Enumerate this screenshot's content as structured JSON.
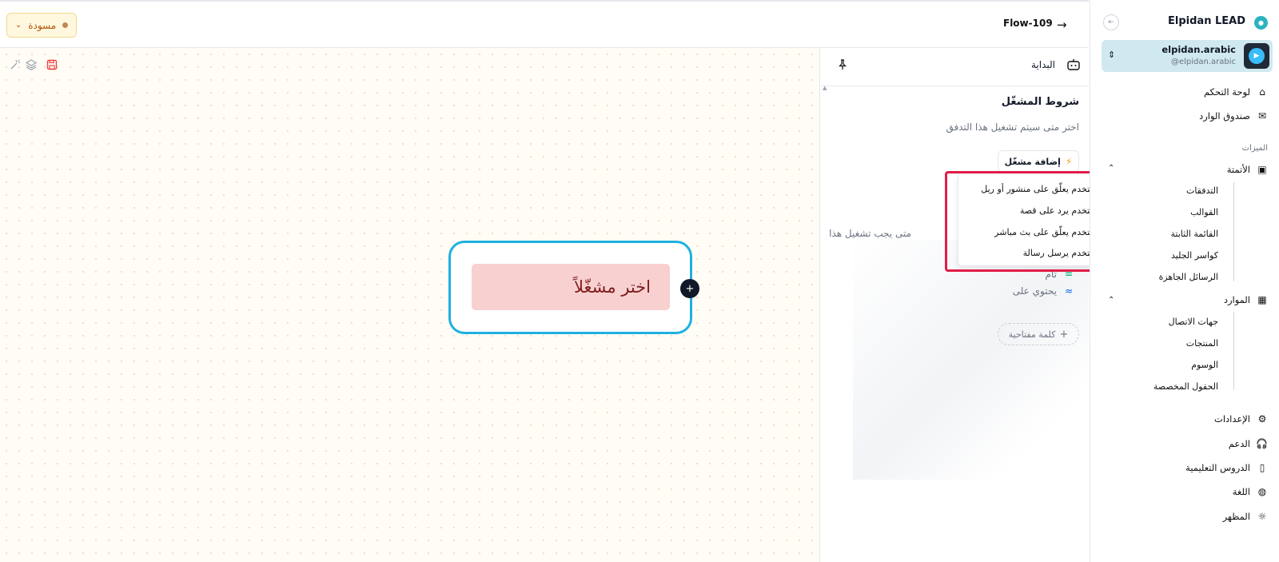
{
  "header": {
    "status_label": "مسودة",
    "flow_title": "Flow-109",
    "back_icon": "arrow-right-icon"
  },
  "canvas": {
    "node_label": "اختر مشغّلاً",
    "node_handle_symbol": "+"
  },
  "panel": {
    "title": "البداية",
    "section_title": "شروط المشغّل",
    "section_desc": "اختر متى سيتم تشغيل هذا التدفق",
    "add_trigger_label": "إضافة مشغّل",
    "partial_text": "متى يجب تشغيل هذا",
    "match_options": [
      {
        "symbol": "=",
        "label": "تام"
      },
      {
        "symbol": "≈",
        "label": "يحتوي على"
      }
    ],
    "keyword_button_label": "كلمة مفتاحية"
  },
  "trigger_menu": {
    "items": [
      "المستخدم يعلّق على منشور أو ريل",
      "المستخدم يرد على قصة",
      "المستخدم يعلّق على بث مباشر",
      "المستخدم يرسل رسالة"
    ]
  },
  "sidebar": {
    "brand": "Elpidan LEAD",
    "account_name": "elpidan.arabic",
    "account_handle": "@elpidan.arabic",
    "main_items": [
      "لوحة التحكم",
      "صندوق الوارد"
    ],
    "section_label": "الميزات",
    "automation_label": "الأتمتة",
    "automation_items": [
      "التدفقات",
      "القوالب",
      "القائمة الثابتة",
      "كواسر الجليد",
      "الرسائل الجاهزة"
    ],
    "resources_label": "الموارد",
    "resources_items": [
      "جهات الاتصال",
      "المنتجات",
      "الوسوم",
      "الحقول المخصصة"
    ],
    "bottom_items": [
      "الإعدادات",
      "الدعم",
      "الدروس التعليمية",
      "اللغة",
      "المظهر"
    ]
  },
  "colors": {
    "node_border": "#1fb0e0",
    "node_fill": "#f8d0d0",
    "highlight": "#e11d48",
    "draft": "#b45309"
  }
}
